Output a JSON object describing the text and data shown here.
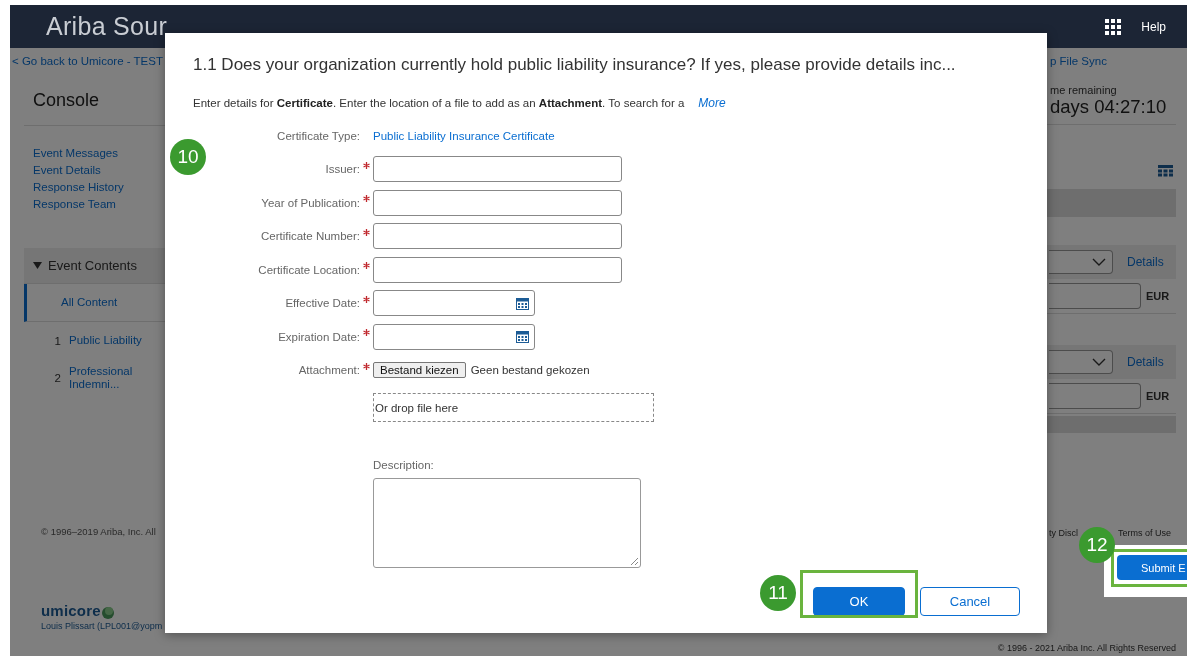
{
  "header": {
    "title": "Ariba Sour",
    "help": "Help"
  },
  "sidebar": {
    "back_link": "< Go back to Umicore - TEST",
    "title": "Console",
    "links": [
      "Event Messages",
      "Event Details",
      "Response History",
      "Response Team"
    ],
    "section": {
      "label": "Event Contents",
      "expanded": true
    },
    "items": [
      {
        "label": "All Content",
        "selected": true
      },
      {
        "number": "1",
        "label": "Public Liability",
        "selected": false
      },
      {
        "number": "2",
        "label": "Professional Indemni...",
        "selected": false
      }
    ],
    "copyright": "© 1996–2019 Ariba, Inc. All",
    "logo": "umicore",
    "user_line": "Louis Plissart (LPL001@yopm"
  },
  "right_panel": {
    "sync_link": "p File Sync",
    "time_label": "me remaining",
    "time_value": "days 04:27:10",
    "rows": [
      {
        "details": "Details",
        "currency": "EUR"
      },
      {
        "details": "Details",
        "currency": "EUR"
      }
    ],
    "footer_links": [
      "ty Discl",
      "Terms of Use"
    ],
    "submit_button": "Submit E",
    "copyright": "© 1996 - 2021 Ariba Inc. All Rights Reserved"
  },
  "dialog": {
    "title": "1.1 Does your organization currently hold public liability insurance? If yes, please provide details inc...",
    "intro": "Enter details for **Certificate**. Enter the location of a file to add as an **Attachment**. To search for a",
    "more_link": "More",
    "fields": [
      {
        "kind": "text",
        "label": "Certificate Type:",
        "required": false,
        "value": "Public Liability Insurance Certificate"
      },
      {
        "kind": "input",
        "label": "Issuer:",
        "required": true
      },
      {
        "kind": "input",
        "label": "Year of Publication:",
        "required": true
      },
      {
        "kind": "input",
        "label": "Certificate Number:",
        "required": true
      },
      {
        "kind": "input",
        "label": "Certificate Location:",
        "required": true
      },
      {
        "kind": "date",
        "label": "Effective Date:",
        "required": true
      },
      {
        "kind": "date",
        "label": "Expiration Date:",
        "required": true
      },
      {
        "kind": "file",
        "label": "Attachment:",
        "required": true,
        "button": "Bestand kiezen",
        "status": "Geen bestand gekozen",
        "drop_hint": "Or drop file here"
      }
    ],
    "description_label": "Description:",
    "buttons": [
      {
        "kind": "primary",
        "label": "OK"
      },
      {
        "kind": "secondary",
        "label": "Cancel"
      }
    ]
  },
  "step_badges": [
    {
      "number": "10",
      "highlight": false
    },
    {
      "number": "11",
      "highlight": true
    },
    {
      "number": "12",
      "highlight": true
    }
  ]
}
